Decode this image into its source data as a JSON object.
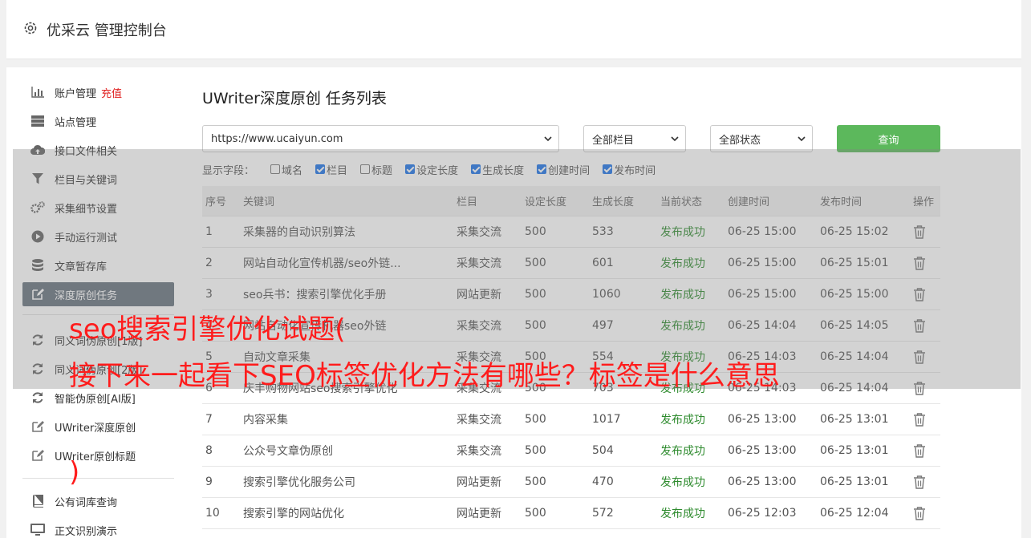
{
  "header": {
    "title": "优采云 管理控制台"
  },
  "sidebar": {
    "items": [
      {
        "label": "账户管理",
        "badge": "充值",
        "icon": "bar-chart-icon"
      },
      {
        "label": "站点管理",
        "icon": "server-icon"
      },
      {
        "label": "接口文件相关",
        "icon": "cloud-upload-icon"
      },
      {
        "label": "栏目与关键词",
        "icon": "filter-icon"
      },
      {
        "label": "采集细节设置",
        "icon": "cogs-icon"
      },
      {
        "label": "手动运行测试",
        "icon": "play-circle-icon"
      },
      {
        "label": "文章暂存库",
        "icon": "database-icon"
      },
      {
        "label": "深度原创任务",
        "icon": "edit-icon",
        "active": true
      },
      {
        "label": "同义词伪原创[1版]",
        "icon": "refresh-icon"
      },
      {
        "label": "同义词伪原创[2版]",
        "icon": "refresh-icon"
      },
      {
        "label": "智能伪原创[AI版]",
        "icon": "refresh-icon"
      },
      {
        "label": "UWriter深度原创",
        "icon": "edit-icon"
      },
      {
        "label": "UWriter原创标题",
        "icon": "edit-icon"
      },
      {
        "label": "公有词库查询",
        "icon": "book-icon"
      },
      {
        "label": "正文识别演示",
        "icon": "monitor-icon"
      }
    ]
  },
  "main": {
    "heading": "UWriter深度原创 任务列表",
    "site_select": "https://www.ucaiyun.com",
    "column_select": "全部栏目",
    "status_select": "全部状态",
    "query_label": "查询",
    "fields_label": "显示字段：",
    "fields": [
      {
        "label": "域名",
        "checked": false
      },
      {
        "label": "栏目",
        "checked": true
      },
      {
        "label": "标题",
        "checked": false
      },
      {
        "label": "设定长度",
        "checked": true
      },
      {
        "label": "生成长度",
        "checked": true
      },
      {
        "label": "创建时间",
        "checked": true
      },
      {
        "label": "发布时间",
        "checked": true
      }
    ],
    "table": {
      "headers": [
        "序号",
        "关键词",
        "栏目",
        "设定长度",
        "生成长度",
        "当前状态",
        "创建时间",
        "发布时间",
        "操作"
      ],
      "rows": [
        [
          "1",
          "采集器的自动识别算法",
          "采集交流",
          "500",
          "533",
          "发布成功",
          "06-25 15:00",
          "06-25 15:02"
        ],
        [
          "2",
          "网站自动化宣传机器/seo外链...",
          "采集交流",
          "500",
          "601",
          "发布成功",
          "06-25 15:00",
          "06-25 15:01"
        ],
        [
          "3",
          "seo兵书：搜索引擎优化手册",
          "网站更新",
          "500",
          "1060",
          "发布成功",
          "06-25 15:00",
          "06-25 15:00"
        ],
        [
          "4",
          "网站自动化宣传机器seo外链",
          "采集交流",
          "500",
          "497",
          "发布成功",
          "06-25 14:04",
          "06-25 14:05"
        ],
        [
          "5",
          "自动文章采集",
          "采集交流",
          "500",
          "554",
          "发布成功",
          "06-25 14:03",
          "06-25 14:04"
        ],
        [
          "6",
          "庆丰购物网站seo搜索引擎优化",
          "采集交流",
          "500",
          "703",
          "发布成功",
          "06-25 14:03",
          "06-25 14:04"
        ],
        [
          "7",
          "内容采集",
          "采集交流",
          "500",
          "1017",
          "发布成功",
          "06-25 13:00",
          "06-25 13:01"
        ],
        [
          "8",
          "公众号文章伪原创",
          "采集交流",
          "500",
          "504",
          "发布成功",
          "06-25 13:00",
          "06-25 13:01"
        ],
        [
          "9",
          "搜索引擎优化服务公司",
          "网站更新",
          "500",
          "470",
          "发布成功",
          "06-25 13:00",
          "06-25 13:01"
        ],
        [
          "10",
          "搜索引擎的网站优化",
          "网站更新",
          "500",
          "572",
          "发布成功",
          "06-25 12:03",
          "06-25 12:04"
        ]
      ]
    }
  },
  "watermark": {
    "line1": "seo搜索引擎优化试题(",
    "line2": "接下来一起看下SEO标签优化方法有哪些？标签是什么意思",
    "line3": ")"
  },
  "colors": {
    "active_bg": "#68737f",
    "query_btn": "#5cb85c",
    "success": "#2e8b2e",
    "watermark": "#ff1c1c"
  }
}
